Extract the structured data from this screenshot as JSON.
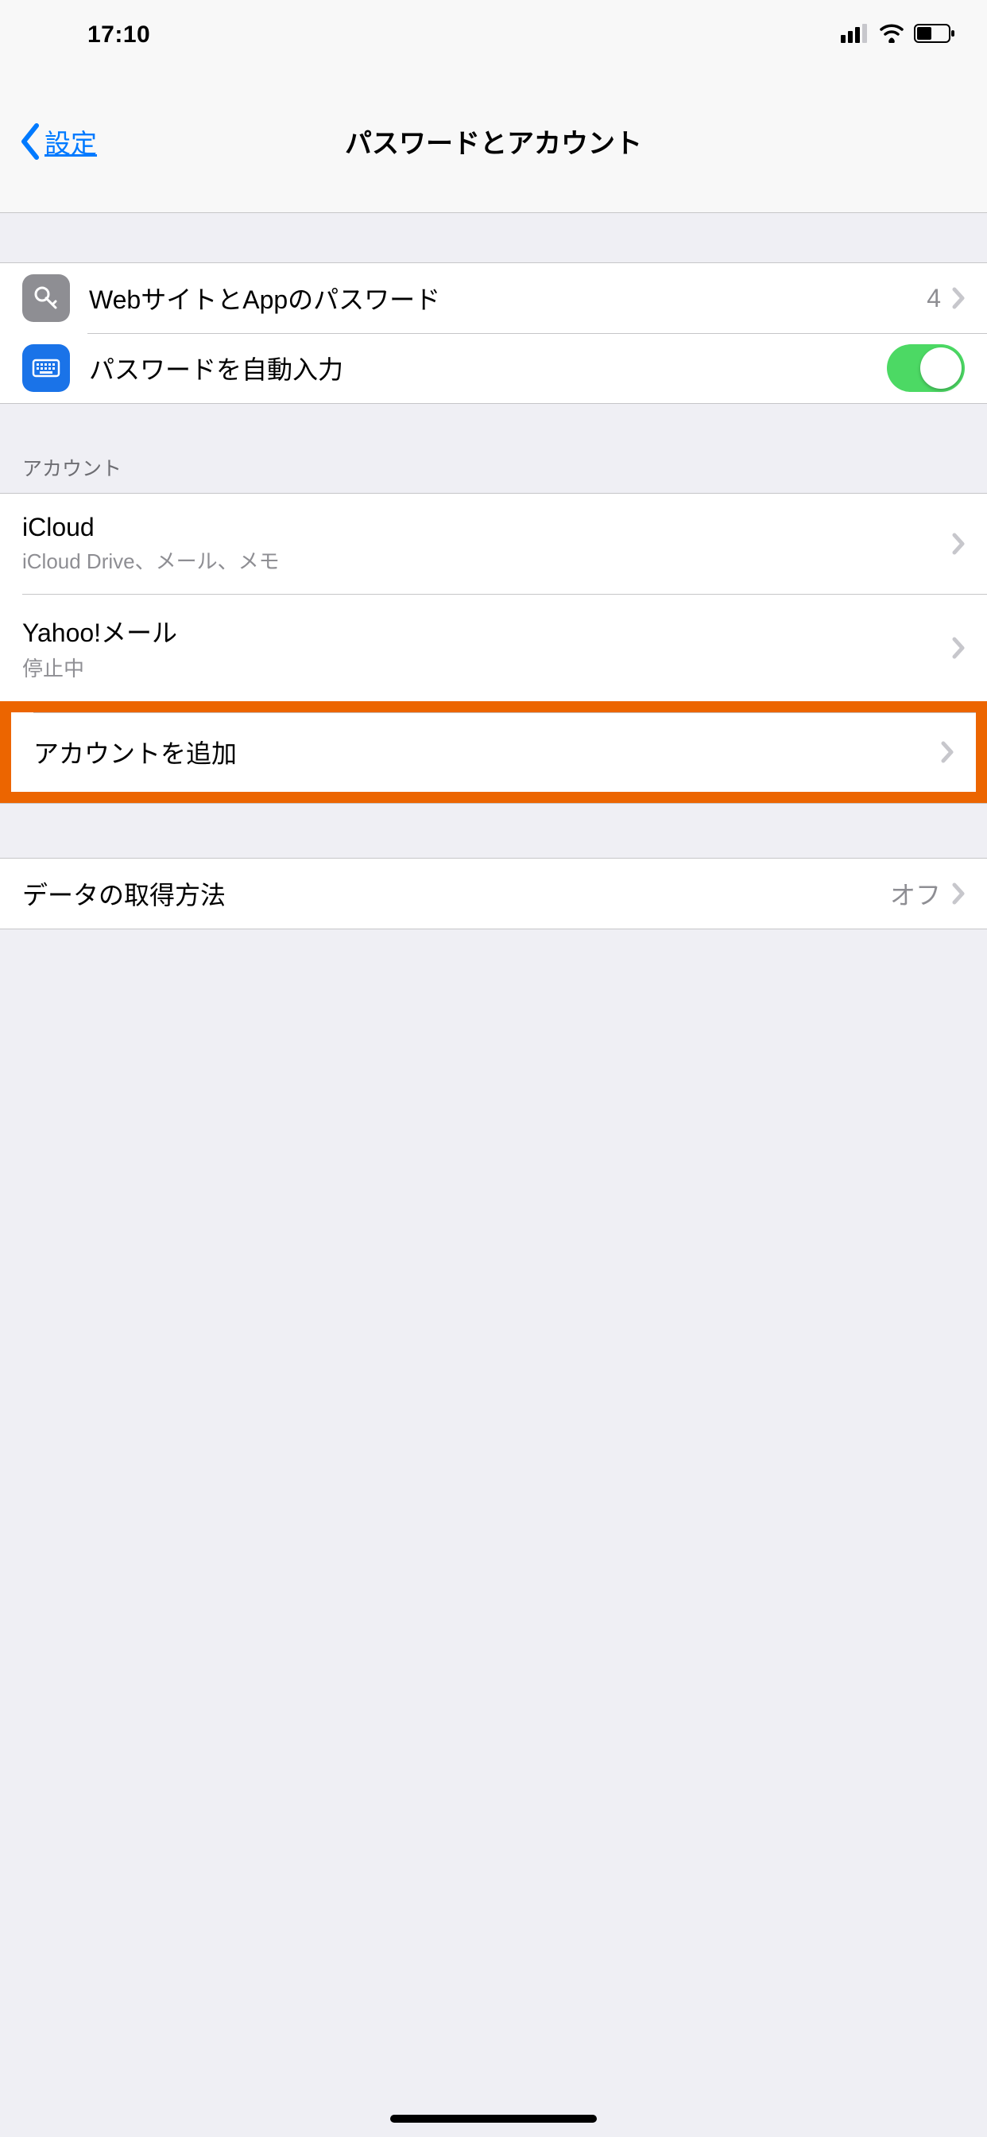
{
  "status": {
    "time": "17:10"
  },
  "nav": {
    "back": "設定",
    "title": "パスワードとアカウント"
  },
  "passwords": {
    "website_app": {
      "label": "WebサイトとAppのパスワード",
      "count": "4"
    },
    "autofill": {
      "label": "パスワードを自動入力",
      "on": true
    }
  },
  "accounts": {
    "header": "アカウント",
    "items": [
      {
        "title": "iCloud",
        "subtitle": "iCloud Drive、メール、メモ"
      },
      {
        "title": "Yahoo!メール",
        "subtitle": "停止中"
      }
    ],
    "add": "アカウントを追加"
  },
  "fetch": {
    "label": "データの取得方法",
    "value": "オフ"
  }
}
